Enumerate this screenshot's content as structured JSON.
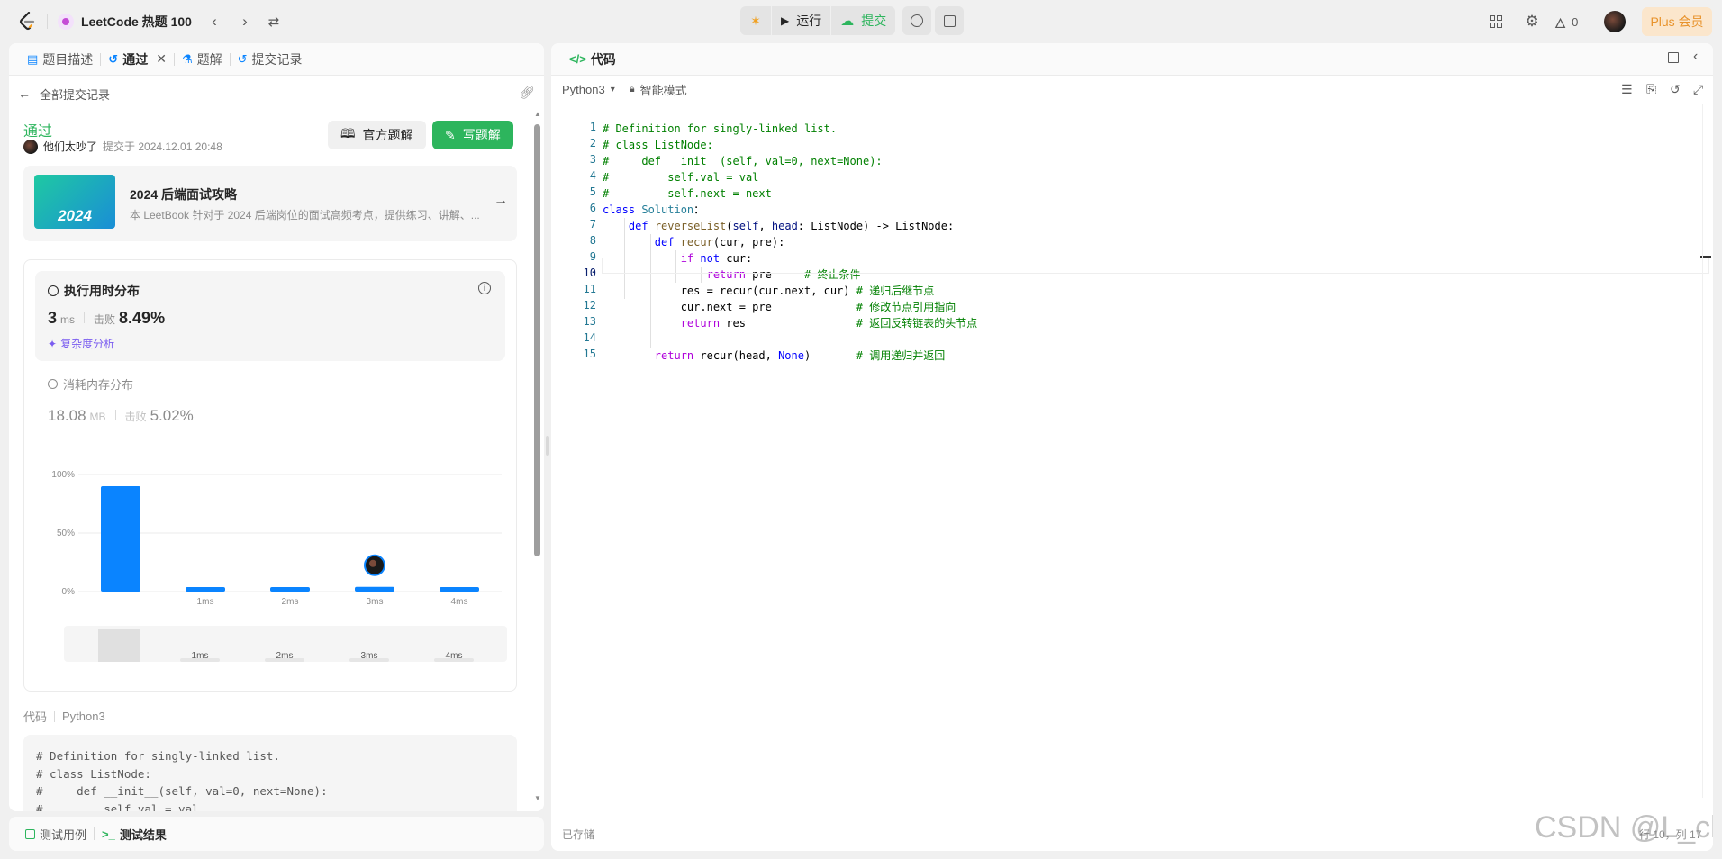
{
  "topbar": {
    "problem_list": "LeetCode 热题 100",
    "run_label": "运行",
    "submit_label": "提交",
    "fire_count": "0",
    "plus_label": "Plus 会员"
  },
  "left": {
    "tabs": [
      {
        "label": "题目描述"
      },
      {
        "label": "通过"
      },
      {
        "label": "题解"
      },
      {
        "label": "提交记录"
      }
    ],
    "back_label": "全部提交记录",
    "status": "通过",
    "user": "他们太吵了",
    "submitted_at": "提交于 2024.12.01 20:48",
    "official_solution": "官方题解",
    "write_solution": "写题解",
    "book": {
      "badge": "2024",
      "title": "2024 后端面试攻略",
      "desc": "本 LeetBook 针对于 2024 后端岗位的面试高频考点，提供练习、讲解、..."
    },
    "runtime": {
      "title": "执行用时分布",
      "value": "3",
      "unit": "ms",
      "beat_label": "击败",
      "beat": "8.49%",
      "analysis": "复杂度分析"
    },
    "memory": {
      "title": "消耗内存分布",
      "value": "18.08",
      "unit": "MB",
      "beat_label": "击败",
      "beat": "5.02%"
    },
    "code_label": "代码",
    "code_lang": "Python3",
    "code_preview": [
      "# Definition for singly-linked list.",
      "# class ListNode:",
      "#     def __init__(self, val=0, next=None):",
      "#         self.val = val"
    ]
  },
  "chart_data": {
    "type": "bar",
    "categories": [
      "",
      "1ms",
      "2ms",
      "3ms",
      "4ms"
    ],
    "values": [
      90,
      3,
      3,
      4,
      3
    ],
    "ylim": [
      0,
      100
    ],
    "y_ticks": [
      "100%",
      "50%",
      "0%"
    ],
    "highlight_category": "3ms",
    "colors": {
      "bar": "#0a84ff"
    }
  },
  "bottom": {
    "testcase": "测试用例",
    "result": "测试结果"
  },
  "editor": {
    "title": "代码",
    "language": "Python3",
    "mode": "智能模式",
    "saved": "已存储",
    "status_right": "行 10，列 17",
    "watermark": "CSDN @L_cl",
    "lines": [
      [
        [
          "cm",
          "# Definition for singly-linked list."
        ]
      ],
      [
        [
          "cm",
          "# class ListNode:"
        ]
      ],
      [
        [
          "cm",
          "#     def __init__(self, val=0, next=None):"
        ]
      ],
      [
        [
          "cm",
          "#         self.val = val"
        ]
      ],
      [
        [
          "cm",
          "#         self.next = next"
        ]
      ],
      [
        [
          "kw",
          "class "
        ],
        [
          "cls",
          "Solution"
        ],
        [
          "",
          "："
        ]
      ],
      [
        [
          "",
          "    "
        ],
        [
          "kw",
          "def "
        ],
        [
          "fn",
          "reverseList"
        ],
        [
          "",
          "("
        ],
        [
          "pm",
          "self"
        ],
        [
          "",
          ", "
        ],
        [
          "pm",
          "head"
        ],
        [
          "",
          ": ListNode) -> ListNode:"
        ]
      ],
      [
        [
          "",
          "        "
        ],
        [
          "kw",
          "def "
        ],
        [
          "fn",
          "recur"
        ],
        [
          "",
          "(cur, pre):"
        ]
      ],
      [
        [
          "",
          "            "
        ],
        [
          "kw2",
          "if "
        ],
        [
          "kw",
          "not "
        ],
        [
          "",
          "cur:"
        ]
      ],
      [
        [
          "",
          "                "
        ],
        [
          "kw2",
          "return "
        ],
        [
          "",
          "pre     "
        ],
        [
          "cm",
          "# 终止条件"
        ]
      ],
      [
        [
          "",
          "            res = recur(cur.next, cur) "
        ],
        [
          "cm",
          "# 递归后继节点"
        ]
      ],
      [
        [
          "",
          "            cur.next = pre             "
        ],
        [
          "cm",
          "# 修改节点引用指向"
        ]
      ],
      [
        [
          "",
          "            "
        ],
        [
          "kw2",
          "return "
        ],
        [
          "",
          "res                 "
        ],
        [
          "cm",
          "# 返回反转链表的头节点"
        ]
      ],
      [
        [
          "",
          ""
        ]
      ],
      [
        [
          "",
          "        "
        ],
        [
          "kw2",
          "return "
        ],
        [
          "",
          "recur(head, "
        ],
        [
          "kw",
          "None"
        ],
        [
          "",
          ")       "
        ],
        [
          "cm",
          "# 调用递归并返回"
        ]
      ]
    ]
  }
}
